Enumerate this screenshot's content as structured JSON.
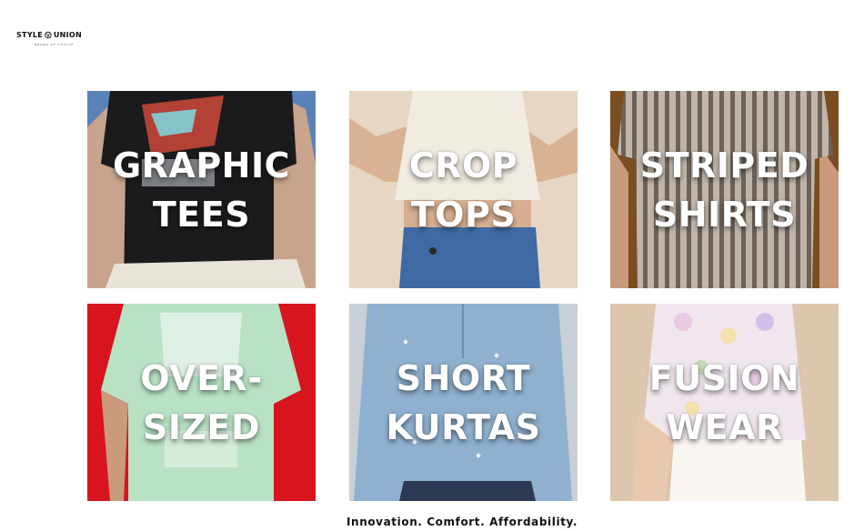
{
  "brand": {
    "name_left": "STYLE",
    "name_right": "UNION",
    "subtitle": "BRAND OF CHOICE"
  },
  "categories": [
    {
      "line1": "GRAPHIC",
      "line2": "TEES",
      "bg": "#5b82b8",
      "garment": "#1b1b1d"
    },
    {
      "line1": "CROP",
      "line2": "TOPS",
      "bg": "#e6d6c3",
      "garment": "#f1ece2"
    },
    {
      "line1": "STRIPED",
      "line2": "SHIRTS",
      "bg": "#7a4e20",
      "garment": "#9c9289"
    },
    {
      "line1": "OVER-",
      "line2": "SIZED",
      "bg": "#d8141e",
      "garment": "#b9e2c5"
    },
    {
      "line1": "SHORT",
      "line2": "KURTAS",
      "bg": "#c9cfd6",
      "garment": "#8fb0cf"
    },
    {
      "line1": "FUSION",
      "line2": "WEAR",
      "bg": "#dcc6ad",
      "garment": "#f0e6ee"
    }
  ],
  "tagline": "Innovation. Comfort. Affordability."
}
